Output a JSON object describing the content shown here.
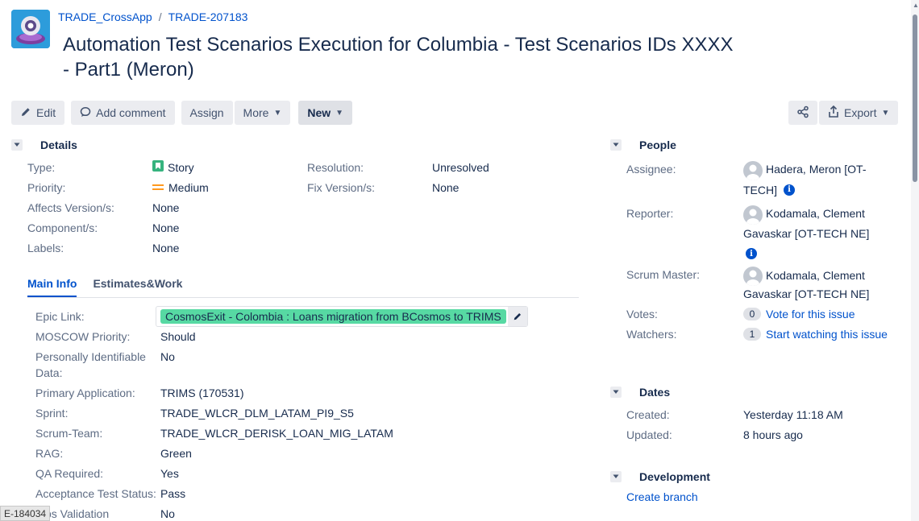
{
  "breadcrumb": {
    "project": "TRADE_CrossApp",
    "issue_key": "TRADE-207183"
  },
  "summary": "Automation Test Scenarios Execution for Columbia - Test Scenarios IDs XXXX - Part1 (Meron)",
  "toolbar": {
    "edit": "Edit",
    "comment": "Add comment",
    "assign": "Assign",
    "more": "More",
    "new": "New",
    "export": "Export"
  },
  "details": {
    "heading": "Details",
    "type_label": "Type:",
    "type_value": "Story",
    "priority_label": "Priority:",
    "priority_value": "Medium",
    "affects_label": "Affects Version/s:",
    "affects_value": "None",
    "component_label": "Component/s:",
    "component_value": "None",
    "labels_label": "Labels:",
    "labels_value": "None",
    "resolution_label": "Resolution:",
    "resolution_value": "Unresolved",
    "fix_label": "Fix Version/s:",
    "fix_value": "None"
  },
  "tabs": {
    "main": "Main Info",
    "estimates": "Estimates&Work"
  },
  "main_info": {
    "epic_label": "Epic Link:",
    "epic_value": "CosmosExit - Colombia : Loans migration from BCosmos to TRIMS",
    "moscow_label": "MOSCOW Priority:",
    "moscow_value": "Should",
    "pii_label_1": "Personally Identifiable",
    "pii_label_2": "Data:",
    "pii_value": "No",
    "primary_label": "Primary Application:",
    "primary_value": "TRIMS (170531)",
    "sprint_label": "Sprint:",
    "sprint_value": "TRADE_WLCR_DLM_LATAM_PI9_S5",
    "scrum_team_label": "Scrum-Team:",
    "scrum_team_value": "TRADE_WLCR_DERISK_LOAN_MIG_LATAM",
    "rag_label": "RAG:",
    "rag_value": "Green",
    "qa_label": "QA Required:",
    "qa_value": "Yes",
    "acceptance_label": "Acceptance Test Status:",
    "acceptance_value": "Pass",
    "ops_label": "ps Validation",
    "ops_value": "No"
  },
  "people": {
    "heading": "People",
    "assignee_label": "Assignee:",
    "assignee_line1": "Hadera, Meron [OT-",
    "assignee_line2": "TECH]",
    "reporter_label": "Reporter:",
    "reporter_line1": "Kodamala, Clement",
    "reporter_line2": "Gavaskar [OT-TECH NE]",
    "scrum_master_label": "Scrum Master:",
    "scrum_master_line1": "Kodamala, Clement",
    "scrum_master_line2": "Gavaskar [OT-TECH NE]",
    "votes_label": "Votes:",
    "votes_count": "0",
    "votes_link": "Vote for this issue",
    "watchers_label": "Watchers:",
    "watchers_count": "1",
    "watchers_link": "Start watching this issue"
  },
  "dates": {
    "heading": "Dates",
    "created_label": "Created:",
    "created_value": "Yesterday 11:18 AM",
    "updated_label": "Updated:",
    "updated_value": "8 hours ago"
  },
  "development": {
    "heading": "Development",
    "create_branch": "Create branch"
  },
  "status_tip": "E-184034"
}
